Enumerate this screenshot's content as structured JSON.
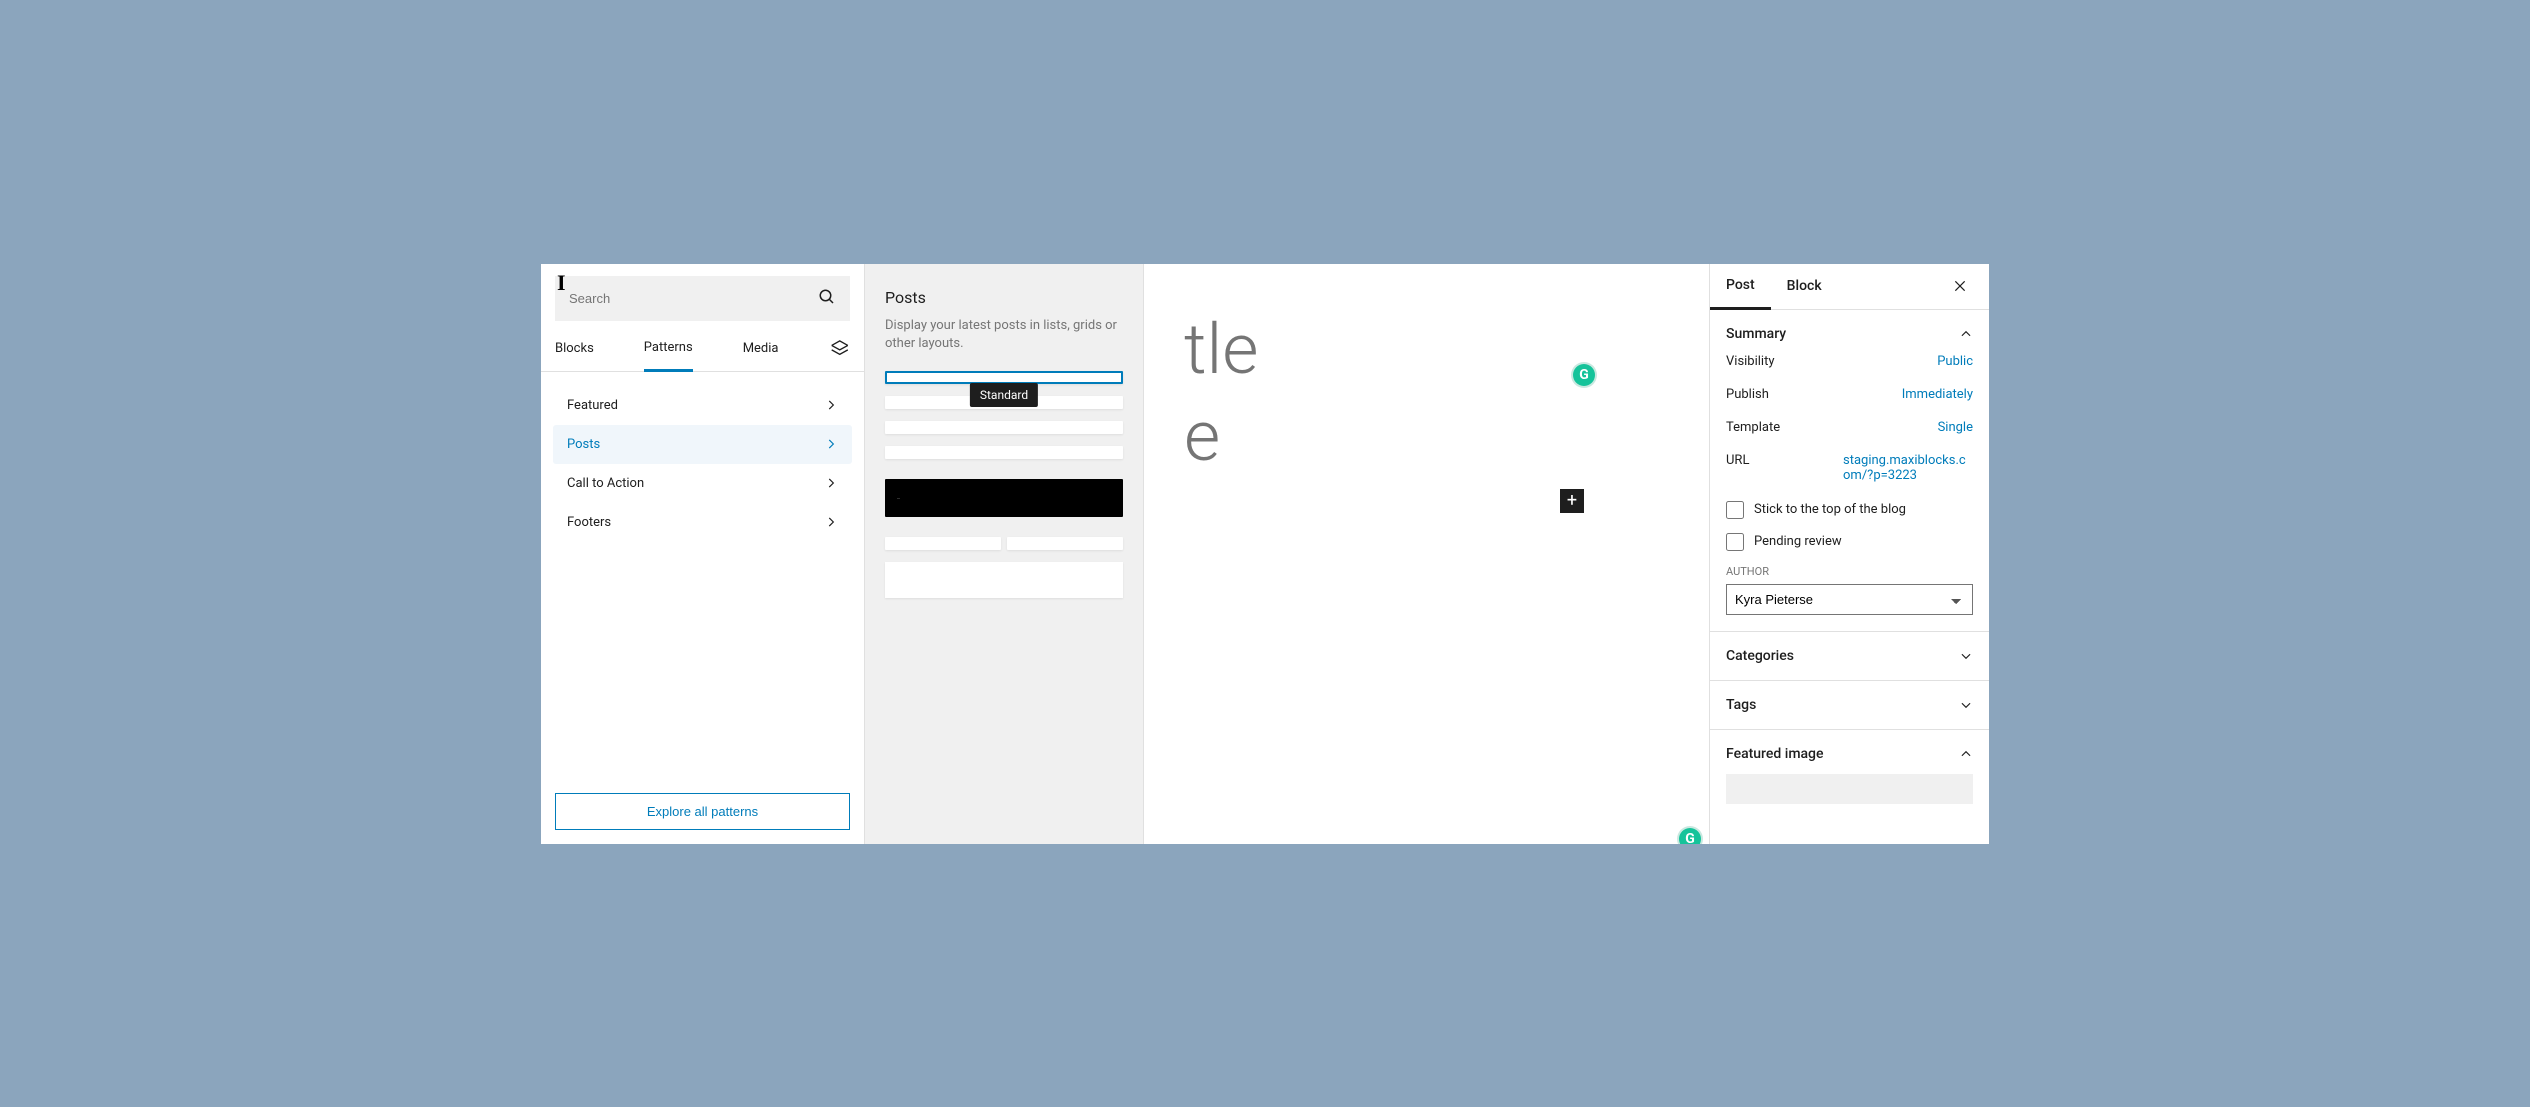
{
  "left_sidebar": {
    "search_placeholder": "Search",
    "tabs": [
      "Blocks",
      "Patterns",
      "Media"
    ],
    "active_tab_index": 1,
    "categories": [
      {
        "label": "Featured",
        "active": false
      },
      {
        "label": "Posts",
        "active": true
      },
      {
        "label": "Call to Action",
        "active": false
      },
      {
        "label": "Footers",
        "active": false
      }
    ],
    "explore_label": "Explore all patterns"
  },
  "preview": {
    "title": "Posts",
    "description": "Display your latest posts in lists, grids or other layouts.",
    "hover_tooltip": "Standard"
  },
  "canvas": {
    "title_fragment_1": "tle",
    "title_fragment_2": "e"
  },
  "right_sidebar": {
    "tabs": [
      "Post",
      "Block"
    ],
    "active_tab_index": 0,
    "panels": {
      "summary": {
        "title": "Summary",
        "rows": {
          "visibility": {
            "label": "Visibility",
            "value": "Public"
          },
          "publish": {
            "label": "Publish",
            "value": "Immediately"
          },
          "template": {
            "label": "Template",
            "value": "Single"
          },
          "url": {
            "label": "URL",
            "value": "staging.maxiblocks.com/?p=3223"
          }
        },
        "stick_label": "Stick to the top of the blog",
        "pending_label": "Pending review",
        "author_label": "AUTHOR",
        "author_value": "Kyra Pieterse"
      },
      "categories": {
        "title": "Categories"
      },
      "tags": {
        "title": "Tags"
      },
      "featured_image": {
        "title": "Featured image"
      }
    }
  }
}
